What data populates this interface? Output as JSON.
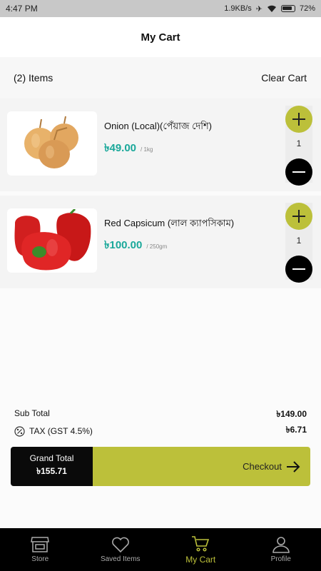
{
  "status_bar": {
    "time": "4:47 PM",
    "network_speed": "1.9KB/s",
    "battery": "72%"
  },
  "header": {
    "title": "My Cart"
  },
  "cart_bar": {
    "items_count": "(2) Items",
    "clear_label": "Clear Cart"
  },
  "items": [
    {
      "name": "Onion (Local)(পেঁয়াজ দেশি)",
      "price": "৳49.00",
      "unit": "/ 1kg",
      "quantity": "1",
      "image_icon": "onion-image"
    },
    {
      "name": "Red Capsicum (লাল ক্যাপসিকাম)",
      "price": "৳100.00",
      "unit": "/ 250gm",
      "quantity": "1",
      "image_icon": "capsicum-image"
    }
  ],
  "summary": {
    "subtotal_label": "Sub Total",
    "subtotal_value": "৳149.00",
    "tax_label": "TAX (GST 4.5%)",
    "tax_value": "৳6.71"
  },
  "checkout": {
    "grand_total_label": "Grand Total",
    "grand_total_value": "৳155.71",
    "checkout_label": "Checkout"
  },
  "bottom_nav": [
    {
      "label": "Store",
      "icon": "store-icon"
    },
    {
      "label": "Saved Items",
      "icon": "heart-icon"
    },
    {
      "label": "My Cart",
      "icon": "cart-icon",
      "active": true
    },
    {
      "label": "Profile",
      "icon": "profile-icon"
    }
  ],
  "colors": {
    "accent": "#bcc03a",
    "price": "#1aa89a",
    "dark": "#000000"
  }
}
